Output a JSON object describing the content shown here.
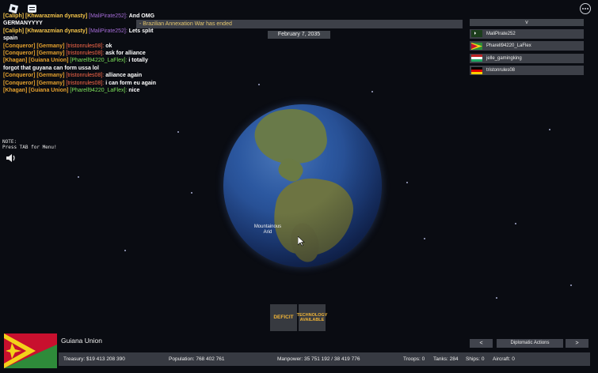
{
  "chat": {
    "lines": [
      {
        "rank": "[Caliph]",
        "nation": "[Khwarazmian dynasty]",
        "user": "[MaliPirate252]:",
        "msg": "And OMG",
        "rank_color": "yellow",
        "user_color": "purple"
      },
      {
        "msg_only": "GERMANYYYY"
      },
      {
        "rank": "[Caliph]",
        "nation": "[Khwarazmian dynasty]",
        "user": "[MaliPirate252]:",
        "msg": "Lets split",
        "rank_color": "yellow",
        "user_color": "purple"
      },
      {
        "msg_only": "spain"
      },
      {
        "rank": "[Conqueror]",
        "nation": "[Germany]",
        "user": "[tristonrules08]:",
        "msg": "ok",
        "rank_color": "orange",
        "user_color": "red"
      },
      {
        "rank": "[Conqueror]",
        "nation": "[Germany]",
        "user": "[tristonrules08]:",
        "msg": "ask for alliance",
        "rank_color": "orange",
        "user_color": "red"
      },
      {
        "rank": "[Khagan]",
        "nation": "[Guiana Union]",
        "user": "[Pharell94220_LaFlex]:",
        "msg": "i totally",
        "rank_color": "orange",
        "user_color": "green"
      },
      {
        "msg_only": "forgot that guyana can form ussa lol"
      },
      {
        "rank": "[Conqueror]",
        "nation": "[Germany]",
        "user": "[tristonrules08]:",
        "msg": "alliance again",
        "rank_color": "orange",
        "user_color": "red"
      },
      {
        "rank": "[Conqueror]",
        "nation": "[Germany]",
        "user": "[tristonrules08]:",
        "msg": "i can form eu again",
        "rank_color": "orange",
        "user_color": "red"
      },
      {
        "rank": "[Khagan]",
        "nation": "[Guiana Union]",
        "user": "[Pharell94220_LaFlex]:",
        "msg": "nice",
        "rank_color": "orange",
        "user_color": "green"
      }
    ]
  },
  "announcement": "- Brazilian Annexation War has ended",
  "date": "February 7, 2035",
  "players": {
    "header": "v",
    "list": [
      {
        "name": "MaliPirate252",
        "flag": "khwarazm-flag"
      },
      {
        "name": "Pharell94220_LaFlex",
        "flag": "guiana-flag"
      },
      {
        "name": "jelle_gamingking",
        "flag": "stripe-flag"
      },
      {
        "name": "tristonrules08",
        "flag": "germany-flag"
      }
    ]
  },
  "note": "NOTE:\nPress TAB for Menu!",
  "terrain_label": {
    "line1": "Mountainous",
    "line2": "Arid"
  },
  "status_buttons": {
    "deficit": "DEFICIT",
    "tech": "TECHNOLOGY AVAILABLE"
  },
  "country": {
    "name": "Guiana Union"
  },
  "stats": {
    "treasury": "Treasury:  $19 413 208 390",
    "population": "Population: 768 402 761",
    "manpower": "Manpower:  35 751 192  /  38 419 776",
    "troops": "Troops: 0",
    "tanks": "Tanks: 284",
    "ships": "Ships: 0",
    "aircraft": "Aircraft: 0"
  },
  "diplomacy": {
    "prev": "<",
    "label": "Diplomatic Actions",
    "next": ">"
  },
  "colors": {
    "accent_gold": "#f0b437",
    "panel": "#464a52"
  }
}
